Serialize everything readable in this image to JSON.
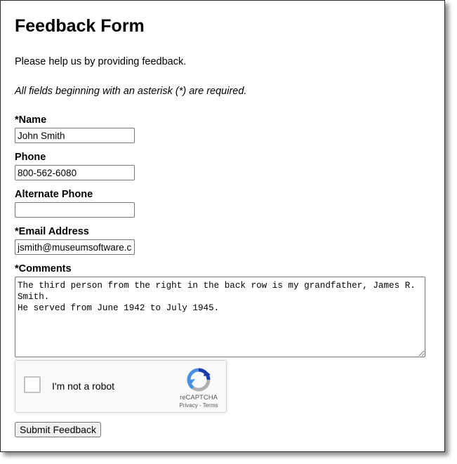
{
  "form": {
    "title": "Feedback Form",
    "intro": "Please help us by providing feedback.",
    "required_note": "All fields beginning with an asterisk (*) are required."
  },
  "fields": {
    "name": {
      "label": "*Name",
      "value": "John Smith"
    },
    "phone": {
      "label": "Phone",
      "value": "800-562-6080"
    },
    "alt_phone": {
      "label": "Alternate Phone",
      "value": ""
    },
    "email": {
      "label": "*Email Address",
      "value": "jsmith@museumsoftware.com"
    },
    "comments": {
      "label": "*Comments",
      "value": "The third person from the right in the back row is my grandfather, James R. Smith.\nHe served from June 1942 to July 1945."
    }
  },
  "captcha": {
    "label": "I'm not a robot",
    "brand": "reCAPTCHA",
    "links": "Privacy - Terms",
    "checked": false
  },
  "submit_label": "Submit Feedback",
  "colors": {
    "captcha_blue": "#1c3aa9",
    "captcha_light_blue": "#4a90e2",
    "captcha_gray": "#b0b0b0"
  }
}
